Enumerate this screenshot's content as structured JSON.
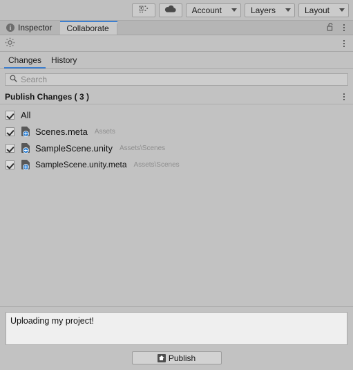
{
  "toolbar": {
    "collab_icon": "collab-cloud-icon",
    "cloud_icon": "cloud-icon",
    "account_label": "Account",
    "layers_label": "Layers",
    "layout_label": "Layout"
  },
  "window_tabs": {
    "inspector_label": "Inspector",
    "collaborate_label": "Collaborate",
    "lock_icon": "unlocked-padlock-icon",
    "menu_icon": "kebab-menu-icon"
  },
  "collab_toolbar": {
    "status_icon": "collab-sync-status-icon",
    "menu_icon": "kebab-menu-icon"
  },
  "subtabs": {
    "changes_label": "Changes",
    "history_label": "History",
    "active": "Changes"
  },
  "search": {
    "placeholder": "Search",
    "value": "",
    "icon": "search-icon"
  },
  "changes": {
    "header_label": "Publish Changes ( 3 )",
    "count": 3,
    "menu_icon": "kebab-menu-icon",
    "all_label": "All",
    "all_checked": true,
    "files": [
      {
        "name": "Scenes.meta",
        "path": "Assets",
        "checked": true,
        "status_icon": "file-added-icon"
      },
      {
        "name": "SampleScene.unity",
        "path": "Assets\\Scenes",
        "checked": true,
        "status_icon": "file-added-icon"
      },
      {
        "name": "SampleScene.unity.meta",
        "path": "Assets\\Scenes",
        "checked": true,
        "status_icon": "file-added-icon"
      }
    ]
  },
  "bottom": {
    "comment_value": "Uploading my project!",
    "comment_placeholder": "",
    "publish_label": "Publish",
    "publish_icon": "upload-icon"
  },
  "colors": {
    "background": "#c2c2c2",
    "accent_blue": "#3c7fd0",
    "badge_blue": "#2b7fd4",
    "panel_light": "#efefef"
  }
}
